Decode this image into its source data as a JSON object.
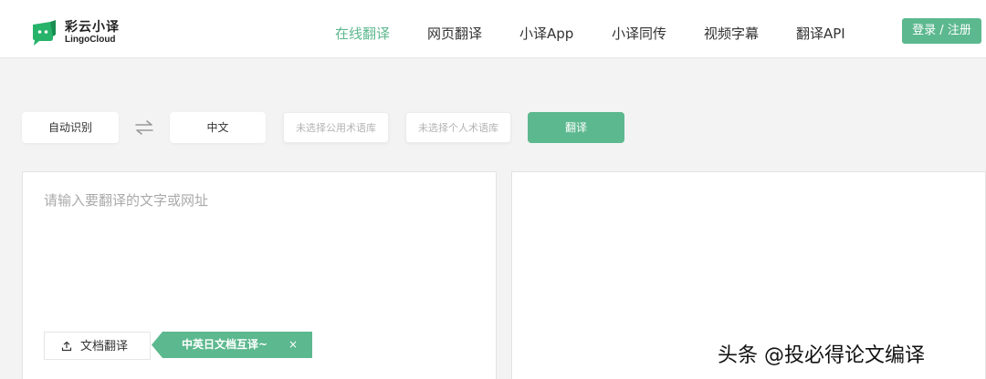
{
  "brand": {
    "name_cn": "彩云小译",
    "name_en": "LingoCloud"
  },
  "nav": {
    "items": [
      {
        "label": "在线翻译",
        "active": true
      },
      {
        "label": "网页翻译",
        "active": false
      },
      {
        "label": "小译App",
        "active": false
      },
      {
        "label": "小译同传",
        "active": false
      },
      {
        "label": "视频字幕",
        "active": false
      },
      {
        "label": "翻译API",
        "active": false
      }
    ],
    "login_label": "登录 / 注册"
  },
  "toolbar": {
    "source_lang": "自动识别",
    "swap_icon": "swap-arrows-icon",
    "target_lang": "中文",
    "public_glossary_placeholder": "未选择公用术语库",
    "personal_glossary_placeholder": "未选择个人术语库",
    "translate_label": "翻译"
  },
  "source": {
    "placeholder": "请输入要翻译的文字或网址",
    "value": ""
  },
  "doc": {
    "upload_icon": "upload-icon",
    "label": "文档翻译",
    "promo_tag": "中英日文档互译~",
    "close_symbol": "×"
  },
  "watermark": "头条 @投必得论文编译",
  "colors": {
    "accent": "#5cb88e",
    "background": "#f3f3f3"
  }
}
